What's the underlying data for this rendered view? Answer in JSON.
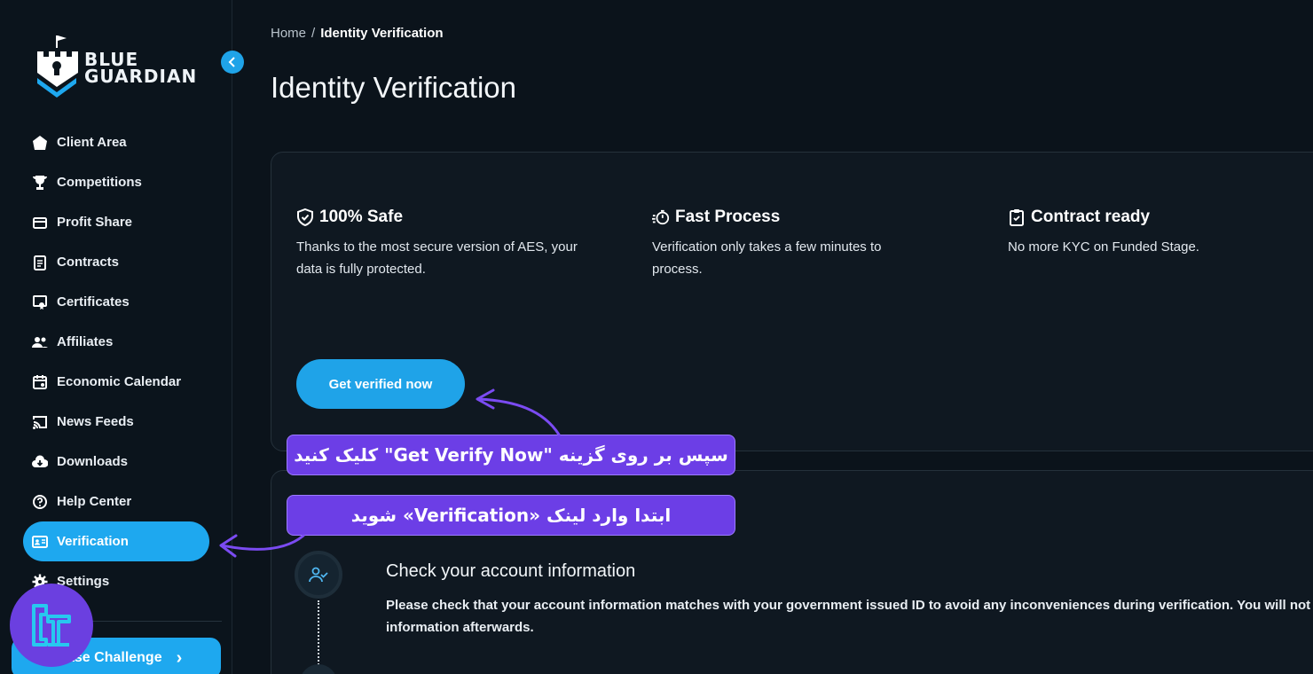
{
  "brand": {
    "line1": "BLUE",
    "line2": "GUARDIAN"
  },
  "sidebar": {
    "items": [
      {
        "label": "Client Area",
        "icon": "home-icon"
      },
      {
        "label": "Competitions",
        "icon": "trophy-icon"
      },
      {
        "label": "Profit Share",
        "icon": "card-icon"
      },
      {
        "label": "Contracts",
        "icon": "contract-icon"
      },
      {
        "label": "Certificates",
        "icon": "certificate-icon"
      },
      {
        "label": "Affiliates",
        "icon": "people-icon"
      },
      {
        "label": "Economic Calendar",
        "icon": "calendar-icon"
      },
      {
        "label": "News Feeds",
        "icon": "cast-icon"
      },
      {
        "label": "Downloads",
        "icon": "cloud-download-icon"
      },
      {
        "label": "Help Center",
        "icon": "help-icon"
      },
      {
        "label": "Verification",
        "icon": "id-card-icon",
        "active": true
      },
      {
        "label": "Settings",
        "icon": "gear-icon"
      }
    ],
    "challenge_button": "ase Challenge"
  },
  "breadcrumb": {
    "home": "Home",
    "separator": "/",
    "current": "Identity Verification"
  },
  "page_title": "Identity Verification",
  "features": [
    {
      "title": "100% Safe",
      "icon": "shield-check-icon",
      "text": "Thanks to the most secure version of AES, your data is fully protected."
    },
    {
      "title": "Fast Process",
      "icon": "stopwatch-icon",
      "text": "Verification only takes a few minutes to process."
    },
    {
      "title": "Contract ready",
      "icon": "clipboard-icon",
      "text": "No more KYC on Funded Stage."
    }
  ],
  "verify_button": "Get verified now",
  "step": {
    "title": "Check your account information",
    "desc_line1": "Please check that your account information matches with your government issued ID to avoid any inconveniences during verification. You will not be",
    "desc_line2": "information afterwards."
  },
  "annotations": {
    "callout_1": "سپس بر روی گزینه \"Get Verify Now\" کلیک کنید",
    "callout_2": "ابتدا وارد لینک «Verification» شوید"
  },
  "colors": {
    "accent": "#1ea8ef",
    "annotation": "#6c3ee6",
    "background": "#0b131b"
  }
}
